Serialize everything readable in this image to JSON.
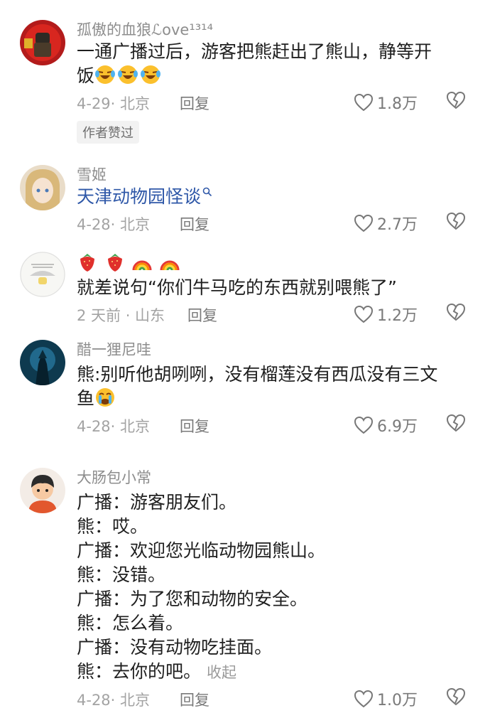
{
  "comments": [
    {
      "username": "孤傲的血狼ℒove¹³¹⁴",
      "lines": [
        "一通广播过后，游客把熊赶出了熊山，静等开",
        "饭"
      ],
      "emoji_after": [
        "laughing-crying-emoji",
        "laughing-crying-emoji",
        "laughing-crying-emoji"
      ],
      "date": "4-29· 北京",
      "reply": "回复",
      "likes": "1.8万",
      "tag": "作者赞过"
    },
    {
      "username": "雪姬",
      "link_text": "天津动物园怪谈",
      "date": "4-28· 北京",
      "reply": "回复",
      "likes": "2.7万"
    },
    {
      "username_emojis": [
        "strawberry-emoji",
        "strawberry-emoji",
        "rainbow-emoji",
        "rainbow-emoji"
      ],
      "lines": [
        "就差说句“你们牛马吃的东西就别喂熊了”"
      ],
      "date": "2 天前 · 山东",
      "reply": "回复",
      "likes": "1.2万"
    },
    {
      "username": "醋一狸尼哇",
      "lines": [
        "熊:别听他胡咧咧，没有榴莲没有西瓜没有三文",
        "鱼"
      ],
      "emoji_after": [
        "crying-emoji"
      ],
      "date": "4-28· 北京",
      "reply": "回复",
      "likes": "6.9万"
    },
    {
      "username": "大肠包小常",
      "lines": [
        "广播：游客朋友们。",
        "熊：哎。",
        "广播：欢迎您光临动物园熊山。",
        "熊：没错。",
        "广播：为了您和动物的安全。",
        "熊：怎么着。",
        "广播：没有动物吃挂面。",
        "熊：去你的吧。"
      ],
      "collapse": "收起",
      "date": "4-28· 北京",
      "reply": "回复",
      "likes": "1.0万"
    }
  ],
  "colors": {
    "username": "#8d8d8d",
    "text": "#1f1f1f",
    "link": "#2f58a8",
    "meta": "#a3a3a3"
  }
}
